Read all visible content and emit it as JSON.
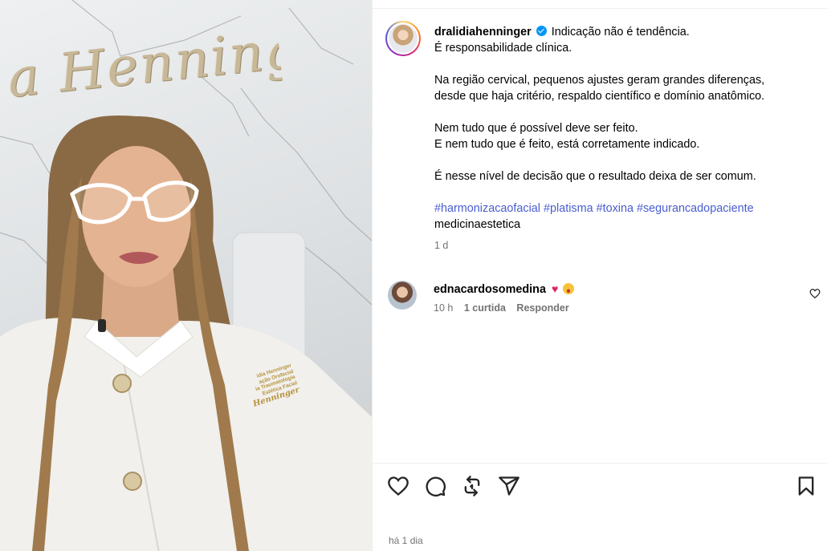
{
  "post": {
    "username": "dralidiahenninger",
    "caption_lines": [
      "Indicação não é tendência.",
      "É responsabilidade clínica.",
      "Na região cervical, pequenos ajustes geram grandes diferenças,",
      "desde que haja critério, respaldo científico e domínio anatômico.",
      "Nem tudo que é possível deve ser feito.",
      "E nem tudo que é feito, está corretamente indicado.",
      "É nesse nível de decisão que o resultado deixa de ser comum."
    ],
    "hashtags": "#harmonizacaofacial #platisma #toxina #segurancadopaciente",
    "hashtag_tail": "medicinaestetica",
    "age": "1 d"
  },
  "media": {
    "wall_sign": "a Henninger",
    "embroidery_lines": [
      "idia Henninger",
      "ação Orofacial",
      "ia Traumatologia",
      "Estética Facial"
    ],
    "embroidery_signature": "Henninger"
  },
  "comment": {
    "username": "ednacardosomedina",
    "emoji_heart": "♥",
    "time": "10 h",
    "likes": "1 curtida",
    "reply": "Responder"
  },
  "footer": {
    "date": "há 1 dia"
  },
  "icons": {
    "like": "heart-icon",
    "comment": "comment-bubble-icon",
    "repost": "repost-icon",
    "share": "share-paper-plane-icon",
    "save": "bookmark-icon"
  },
  "colors": {
    "hashtag": "#4a5dd0",
    "verified": "#0095f6",
    "muted": "#737373"
  }
}
